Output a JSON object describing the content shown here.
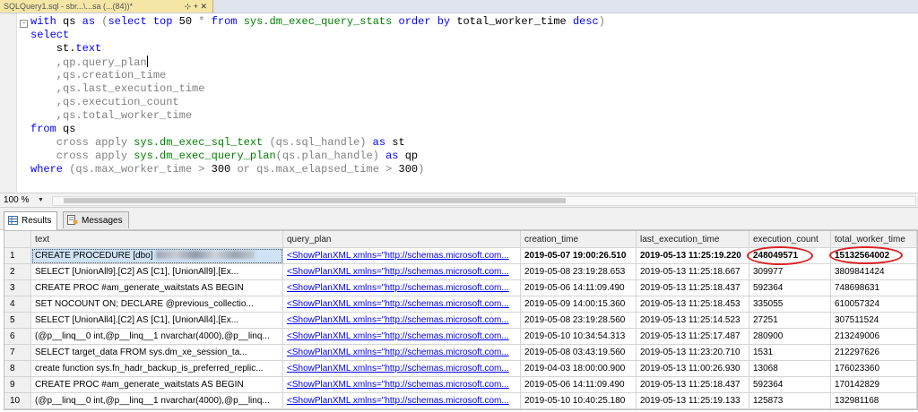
{
  "window": {
    "tab_title": "SQLQuery1.sql - sbr...\\...sa (...(84))*",
    "tab_controls": "⊹ + ✕"
  },
  "editor": {
    "lines": [
      [
        {
          "t": "with ",
          "c": "kw"
        },
        {
          "t": "qs ",
          "c": ""
        },
        {
          "t": "as ",
          "c": "kw"
        },
        {
          "t": "(",
          "c": "gr"
        },
        {
          "t": "select top ",
          "c": "kw"
        },
        {
          "t": "50 ",
          "c": ""
        },
        {
          "t": "* ",
          "c": "gr"
        },
        {
          "t": "from ",
          "c": "kw"
        },
        {
          "t": "sys.dm_exec_query_stats ",
          "c": "sys"
        },
        {
          "t": "order by ",
          "c": "kw"
        },
        {
          "t": "total_worker_time ",
          "c": ""
        },
        {
          "t": "desc",
          "c": "kw"
        },
        {
          "t": ")",
          "c": "gr"
        }
      ],
      [
        {
          "t": "select",
          "c": "kw"
        }
      ],
      [
        {
          "t": "    st.",
          "c": ""
        },
        {
          "t": "text",
          "c": "kw"
        }
      ],
      [
        {
          "t": "    ,qp.query_plan",
          "c": "gr"
        },
        {
          "t": "",
          "c": "caret"
        }
      ],
      [
        {
          "t": "    ,qs.creation_time",
          "c": "gr"
        }
      ],
      [
        {
          "t": "    ,qs.last_execution_time",
          "c": "gr"
        }
      ],
      [
        {
          "t": "    ,qs.execution_count",
          "c": "gr"
        }
      ],
      [
        {
          "t": "    ,qs.total_worker_time",
          "c": "gr"
        }
      ],
      [
        {
          "t": "from ",
          "c": "kw"
        },
        {
          "t": "qs",
          "c": ""
        }
      ],
      [
        {
          "t": "    cross apply ",
          "c": "gr"
        },
        {
          "t": "sys.dm_exec_sql_text ",
          "c": "sys"
        },
        {
          "t": "(qs.sql_handle) ",
          "c": "gr"
        },
        {
          "t": "as ",
          "c": "kw"
        },
        {
          "t": "st",
          "c": ""
        }
      ],
      [
        {
          "t": "    cross apply ",
          "c": "gr"
        },
        {
          "t": "sys.dm_exec_query_plan",
          "c": "sys"
        },
        {
          "t": "(qs.plan_handle) ",
          "c": "gr"
        },
        {
          "t": "as ",
          "c": "kw"
        },
        {
          "t": "qp",
          "c": ""
        }
      ],
      [
        {
          "t": "where ",
          "c": "kw"
        },
        {
          "t": "(qs.max_worker_time ",
          "c": "gr"
        },
        {
          "t": "> ",
          "c": "gr"
        },
        {
          "t": "300 ",
          "c": ""
        },
        {
          "t": "or ",
          "c": "gr"
        },
        {
          "t": "qs.max_elapsed_time ",
          "c": "gr"
        },
        {
          "t": "> ",
          "c": "gr"
        },
        {
          "t": "300",
          "c": ""
        },
        {
          "t": ")",
          "c": "gr"
        }
      ]
    ]
  },
  "zoom": {
    "value": "100 %"
  },
  "result_tabs": [
    {
      "label": "Results",
      "icon": "grid-icon",
      "active": true
    },
    {
      "label": "Messages",
      "icon": "messages-icon",
      "active": false
    }
  ],
  "grid": {
    "columns": [
      "text",
      "query_plan",
      "creation_time",
      "last_execution_time",
      "execution_count",
      "total_worker_time"
    ],
    "rows": [
      [
        "1",
        "CREATE PROCEDURE [dbo]",
        "<ShowPlanXML xmlns=\"http://schemas.microsoft.com...",
        "2019-05-07 19:00:26.510",
        "2019-05-13 11:25:19.220",
        "248049571",
        "15132564002"
      ],
      [
        "2",
        "SELECT      [UnionAll9].[C2] AS [C1],      [UnionAll9].[Ex...",
        "<ShowPlanXML xmlns=\"http://schemas.microsoft.com...",
        "2019-05-08 23:19:28.653",
        "2019-05-13 11:25:18.667",
        "309977",
        "3809841424"
      ],
      [
        "3",
        "  CREATE PROC #am_generate_waitstats AS   BEGIN",
        "<ShowPlanXML xmlns=\"http://schemas.microsoft.com...",
        "2019-05-06 14:11:09.490",
        "2019-05-13 11:25:18.437",
        "592364",
        "748698631"
      ],
      [
        "4",
        "  SET NOCOUNT ON;    DECLARE @previous_collectio...",
        "<ShowPlanXML xmlns=\"http://schemas.microsoft.com...",
        "2019-05-09 14:00:15.360",
        "2019-05-13 11:25:18.453",
        "335055",
        "610057324"
      ],
      [
        "5",
        "SELECT      [UnionAll4].[C2] AS [C1],      [UnionAll4].[Ex...",
        "<ShowPlanXML xmlns=\"http://schemas.microsoft.com...",
        "2019-05-08 23:19:28.560",
        "2019-05-13 11:25:14.523",
        "27251",
        "307511524"
      ],
      [
        "6",
        "(@p__linq__0 int,@p__linq__1 nvarchar(4000),@p__linq...",
        "<ShowPlanXML xmlns=\"http://schemas.microsoft.com...",
        "2019-05-10 10:34:54.313",
        "2019-05-13 11:25:17.487",
        "280900",
        "213249006"
      ],
      [
        "7",
        "SELECT target_data          FROM sys.dm_xe_session_ta...",
        "<ShowPlanXML xmlns=\"http://schemas.microsoft.com...",
        "2019-05-08 03:43:19.560",
        "2019-05-13 11:23:20.710",
        "1531",
        "212297626"
      ],
      [
        "8",
        "  create function sys.fn_hadr_backup_is_preferred_replic...",
        "<ShowPlanXML xmlns=\"http://schemas.microsoft.com...",
        "2019-04-03 18:00:00.900",
        "2019-05-13 11:00:26.930",
        "13068",
        "176023360"
      ],
      [
        "9",
        "  CREATE PROC #am_generate_waitstats AS   BEGIN",
        "<ShowPlanXML xmlns=\"http://schemas.microsoft.com...",
        "2019-05-06 14:11:09.490",
        "2019-05-13 11:25:18.437",
        "592364",
        "170142829"
      ],
      [
        "10",
        "(@p__linq__0 int,@p__linq__1 nvarchar(4000),@p__linq...",
        "<ShowPlanXML xmlns=\"http://schemas.microsoft.com...",
        "2019-05-10 10:40:25.180",
        "2019-05-13 11:25:19.133",
        "125873",
        "132981168"
      ]
    ],
    "selected_row": 0
  },
  "colors": {
    "keyword": "#0000ff",
    "operator": "#808080",
    "system_object": "#008000",
    "selection": "#cfe3f7",
    "highlight_circle": "#d92020"
  }
}
